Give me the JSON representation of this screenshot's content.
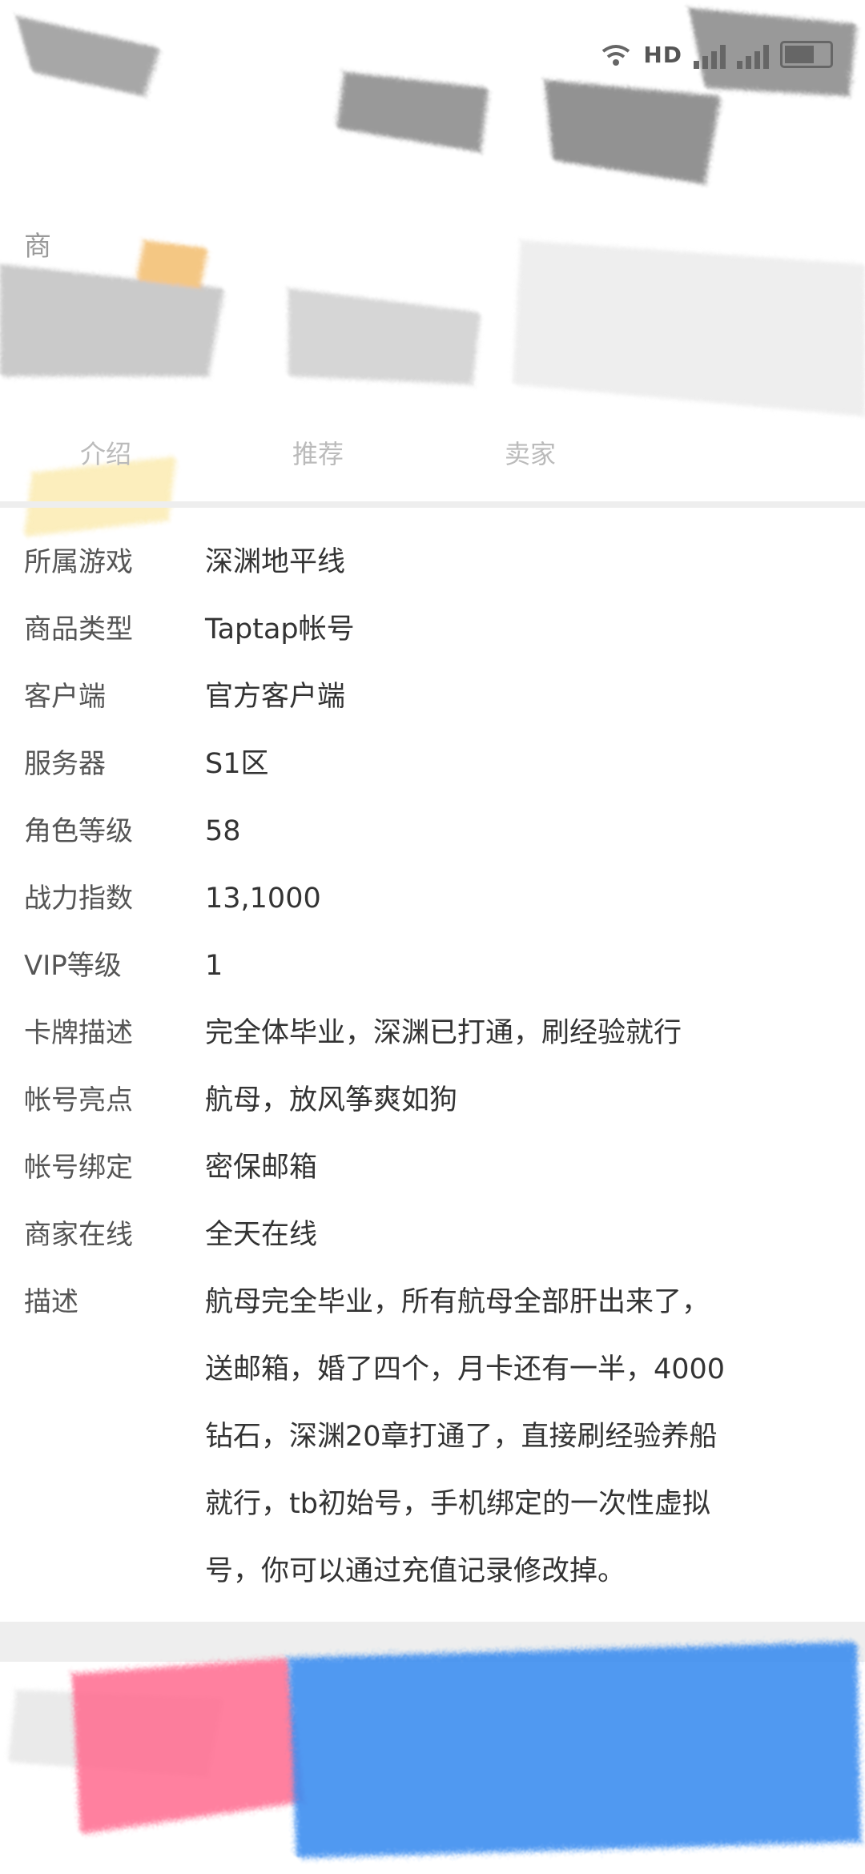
{
  "status_bar": {
    "network": "HD",
    "icons": [
      "wifi-icon",
      "hd-icon",
      "signal-icon",
      "signal-icon",
      "battery-icon"
    ]
  },
  "header": {
    "title": "商",
    "tabs": [
      "介绍",
      "推荐",
      "卖家"
    ]
  },
  "details": [
    {
      "label": "所属游戏",
      "value": "深渊地平线"
    },
    {
      "label": "商品类型",
      "value": "Taptap帐号"
    },
    {
      "label": "客户端",
      "value": "官方客户端"
    },
    {
      "label": "服务器",
      "value": "S1区"
    },
    {
      "label": "角色等级",
      "value": "58"
    },
    {
      "label": "战力指数",
      "value": "13,1000"
    },
    {
      "label": "VIP等级",
      "value": "1"
    },
    {
      "label": "卡牌描述",
      "value": "完全体毕业，深渊已打通，刷经验就行"
    },
    {
      "label": "帐号亮点",
      "value": "航母，放风筝爽如狗"
    },
    {
      "label": "帐号绑定",
      "value": "密保邮箱"
    },
    {
      "label": "商家在线",
      "value": "全天在线"
    }
  ],
  "description": {
    "label": "描述",
    "lines": [
      "航母完全毕业，所有航母全部肝出来了，",
      "送邮箱，婚了四个，月卡还有一半，4000",
      "钻石，深渊20章打通了，直接刷经验养船",
      "就行，tb初始号，手机绑定的一次性虚拟",
      "号，你可以通过充值记录修改掉。"
    ]
  },
  "colors": {
    "accent_pink": "#ff6b8f",
    "accent_blue": "#3d8ef0",
    "label_gray": "#555555",
    "value_dark": "#333333"
  }
}
